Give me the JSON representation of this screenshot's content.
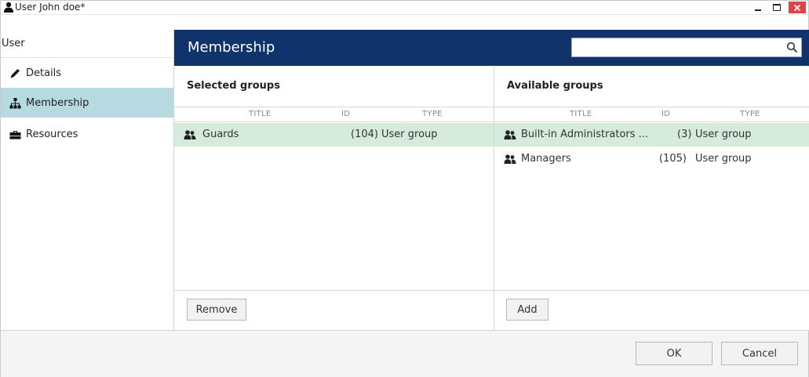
{
  "window": {
    "title": "User John doe*"
  },
  "nav": {
    "header": "User",
    "items": [
      {
        "label": "Details",
        "icon": "pencil-icon"
      },
      {
        "label": "Membership",
        "icon": "org-chart-icon",
        "active": true
      },
      {
        "label": "Resources",
        "icon": "briefcase-icon"
      }
    ]
  },
  "header": {
    "title": "Membership",
    "search_value": ""
  },
  "selected": {
    "title": "Selected groups",
    "columns": [
      "TITLE",
      "ID",
      "TYPE"
    ],
    "rows": [
      {
        "title": "Guards",
        "id": "(104)",
        "type": "User group",
        "selected": true
      }
    ],
    "remove_label": "Remove"
  },
  "available": {
    "title": "Available groups",
    "columns": [
      "TITLE",
      "ID",
      "TYPE"
    ],
    "rows": [
      {
        "title": "Built-in Administrators ...",
        "id": "(3)",
        "type": "User group",
        "selected": true
      },
      {
        "title": "Managers",
        "id": "(105)",
        "type": "User group",
        "selected": false
      }
    ],
    "add_label": "Add"
  },
  "footer": {
    "ok_label": "OK",
    "cancel_label": "Cancel"
  },
  "colors": {
    "header_bg": "#11336b",
    "nav_active": "#b7d9e0",
    "row_selected": "#d6ebdc",
    "close_button": "#e04343"
  }
}
